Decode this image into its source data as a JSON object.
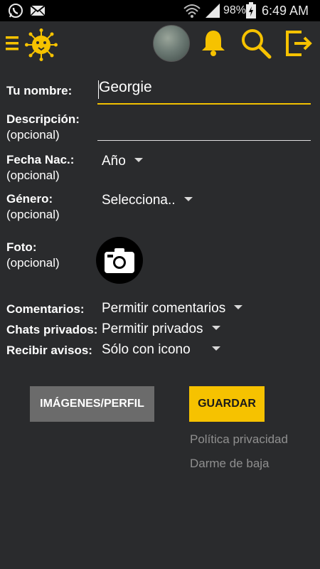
{
  "status_bar": {
    "battery": "98%",
    "time": "6:49 AM",
    "icons": [
      "whatsapp-icon",
      "mail-icon",
      "wifi-icon",
      "signal-icon",
      "battery-icon"
    ]
  },
  "app_bar": {
    "icons": [
      "menu-icon",
      "lion-logo-icon",
      "avatar",
      "bell-icon",
      "search-icon",
      "logout-icon"
    ],
    "accent_color": "#f6c200"
  },
  "form": {
    "name": {
      "label": "Tu nombre:",
      "value": "Georgie"
    },
    "description": {
      "label": "Descripción:",
      "sublabel": "(opcional)",
      "value": ""
    },
    "birth": {
      "label": "Fecha Nac.:",
      "sublabel": "(opcional)",
      "value": "Año"
    },
    "gender": {
      "label": "Género:",
      "sublabel": "(opcional)",
      "value": "Selecciona.."
    },
    "photo": {
      "label": "Foto:",
      "sublabel": "(opcional)"
    },
    "comments": {
      "label": "Comentarios:",
      "value": "Permitir comentarios"
    },
    "private_chats": {
      "label": "Chats privados:",
      "value": "Permitir privados"
    },
    "notices": {
      "label": "Recibir avisos:",
      "value": "Sólo con icono"
    }
  },
  "buttons": {
    "images_profile": "IMÁGENES/PERFIL",
    "save": "GUARDAR"
  },
  "links": {
    "privacy": "Política privacidad",
    "unsubscribe": "Darme de baja"
  }
}
